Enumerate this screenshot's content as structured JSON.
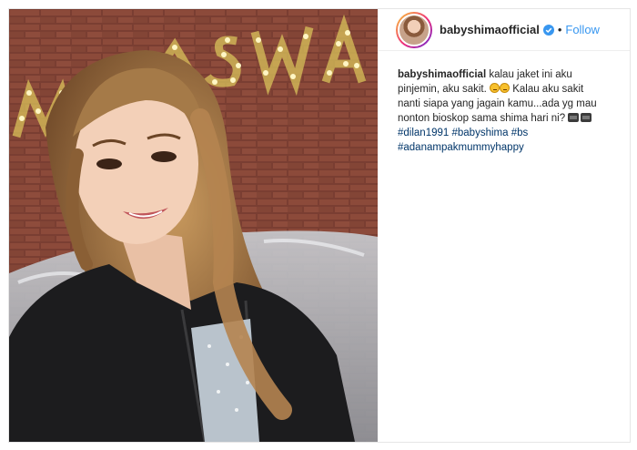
{
  "post": {
    "username": "babyshimaofficial",
    "follow_label": "Follow",
    "separator": "•",
    "caption": {
      "line1": "kalau jaket ini aku",
      "line2": "pinjemin, aku sakit.",
      "line2b": "Kalau aku sakit",
      "line3": "nanti siapa yang jagain kamu...ada yg mau",
      "line4": "nonton bioskop sama shima hari ni?"
    },
    "hashtags_line1": [
      "#dilan1991",
      "#babyshima",
      "#bs"
    ],
    "hashtags_line2": [
      "#adanampakmummyhappy"
    ]
  },
  "photo": {
    "sign_text": "MASWA"
  },
  "colors": {
    "link": "#3897f0",
    "hashtag": "#003569",
    "verified": "#3897f0"
  },
  "icons": [
    "verified-badge-icon",
    "worried-face-emoji-icon",
    "movie-camera-emoji-icon"
  ]
}
